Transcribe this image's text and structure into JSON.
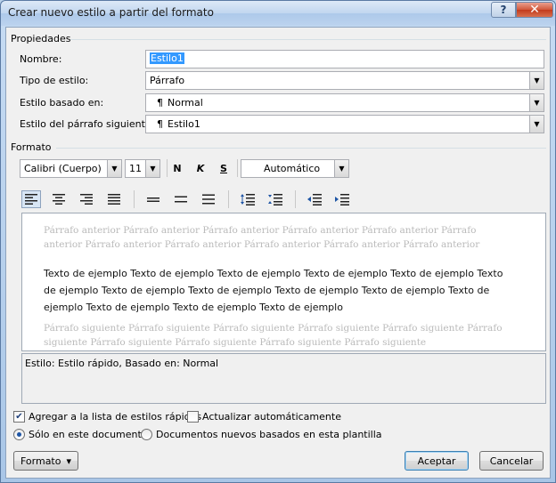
{
  "window": {
    "title": "Crear nuevo estilo a partir del formato",
    "help_symbol": "?",
    "close_symbol": "✕"
  },
  "properties": {
    "section_label": "Propiedades",
    "name_label": "Nombre:",
    "name_value": "Estilo1",
    "type_label": "Tipo de estilo:",
    "type_value": "Párrafo",
    "based_label": "Estilo basado en:",
    "based_value": "Normal",
    "next_label": "Estilo del párrafo siguiente:",
    "next_value": "Estilo1",
    "paragraph_mark": "¶"
  },
  "format": {
    "section_label": "Formato",
    "font_value": "Calibri (Cuerpo)",
    "size_value": "11",
    "bold_glyph": "N",
    "italic_glyph": "K",
    "underline_glyph": "S",
    "color_value": "Automático"
  },
  "preview": {
    "previous_text": "Párrafo anterior Párrafo anterior Párrafo anterior Párrafo anterior Párrafo anterior Párrafo anterior Párrafo anterior Párrafo anterior Párrafo anterior Párrafo anterior Párrafo anterior",
    "sample_text": "Texto de ejemplo Texto de ejemplo Texto de ejemplo Texto de ejemplo Texto de ejemplo Texto de ejemplo Texto de ejemplo Texto de ejemplo Texto de ejemplo Texto de ejemplo Texto de ejemplo Texto de ejemplo Texto de ejemplo Texto de ejemplo",
    "next_text": "Párrafo siguiente Párrafo siguiente Párrafo siguiente Párrafo siguiente Párrafo siguiente Párrafo siguiente Párrafo siguiente Párrafo siguiente Párrafo siguiente Párrafo siguiente"
  },
  "description": "Estilo: Estilo rápido, Basado en: Normal",
  "options": {
    "add_quick_styles": "Agregar a la lista de estilos rápidos",
    "add_quick_styles_checked": true,
    "auto_update": "Actualizar automáticamente",
    "auto_update_checked": false,
    "only_this_document": "Sólo en este documento",
    "new_documents": "Documentos nuevos basados en esta plantilla",
    "selected_scope": "only_this_document"
  },
  "buttons": {
    "format_menu": "Formato",
    "format_menu_arrow": "▾",
    "accept": "Aceptar",
    "cancel": "Cancelar"
  },
  "colors": {
    "selection": "#3399ff",
    "faint_text": "#bababa",
    "close_red": "#c23b1d"
  }
}
